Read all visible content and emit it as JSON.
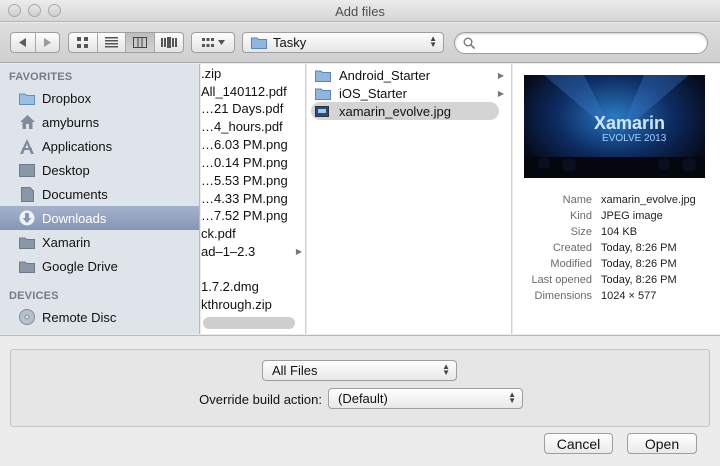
{
  "window": {
    "title": "Add files"
  },
  "toolbar": {
    "location": "Tasky",
    "search_placeholder": ""
  },
  "sidebar": {
    "favorites_header": "FAVORITES",
    "favorites": [
      {
        "label": "Dropbox",
        "icon": "dropbox-folder-icon"
      },
      {
        "label": "amyburns",
        "icon": "home-icon"
      },
      {
        "label": "Applications",
        "icon": "applications-icon"
      },
      {
        "label": "Desktop",
        "icon": "desktop-icon"
      },
      {
        "label": "Documents",
        "icon": "documents-icon"
      },
      {
        "label": "Downloads",
        "icon": "downloads-icon",
        "selected": true
      },
      {
        "label": "Xamarin",
        "icon": "folder-icon"
      },
      {
        "label": "Google Drive",
        "icon": "folder-icon"
      }
    ],
    "devices_header": "DEVICES",
    "devices": [
      {
        "label": "Remote Disc",
        "icon": "disc-icon"
      }
    ]
  },
  "column1": {
    "items": [
      ".zip",
      "All_140112.pdf",
      "…21 Days.pdf",
      "…4_hours.pdf",
      "…6.03 PM.png",
      "…0.14 PM.png",
      "…5.53 PM.png",
      "…4.33 PM.png",
      "…7.52 PM.png",
      "ck.pdf",
      "ad–1–2.3",
      "",
      "1.7.2.dmg",
      "kthrough.zip"
    ]
  },
  "column2": {
    "items": [
      {
        "label": "Android_Starter",
        "type": "folder"
      },
      {
        "label": "iOS_Starter",
        "type": "folder"
      },
      {
        "label": "xamarin_evolve.jpg",
        "type": "image",
        "selected": true
      }
    ]
  },
  "preview": {
    "thumbnail_text_1": "Xamarin",
    "thumbnail_text_2": "EVOLVE 2013",
    "fields": [
      {
        "key": "Name",
        "value": "xamarin_evolve.jpg"
      },
      {
        "key": "Kind",
        "value": "JPEG image"
      },
      {
        "key": "Size",
        "value": "104 KB"
      },
      {
        "key": "Created",
        "value": "Today, 8:26 PM"
      },
      {
        "key": "Modified",
        "value": "Today, 8:26 PM"
      },
      {
        "key": "Last opened",
        "value": "Today, 8:26 PM"
      },
      {
        "key": "Dimensions",
        "value": "1024 × 577"
      }
    ]
  },
  "options": {
    "filter_value": "All Files",
    "override_label": "Override build action:",
    "override_value": "(Default)"
  },
  "buttons": {
    "cancel": "Cancel",
    "open": "Open"
  },
  "colors": {
    "selection": "#8f9fbf",
    "sidebar_bg": "#dfe4ea"
  }
}
